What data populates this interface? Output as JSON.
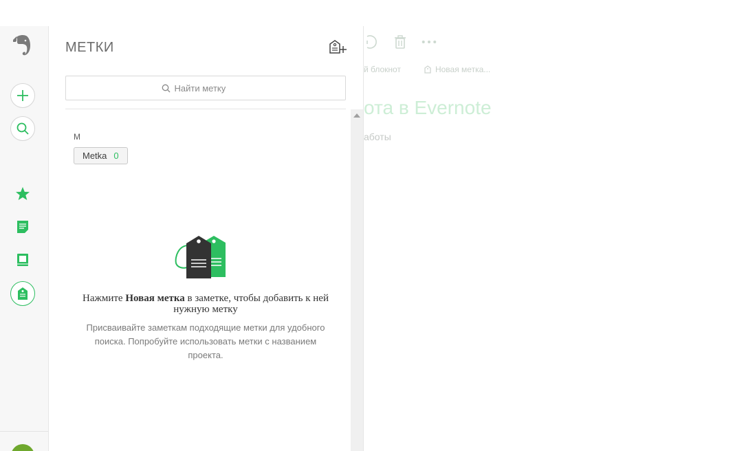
{
  "editor": {
    "meta_notebook": "й блокнот",
    "meta_new_tag": "Новая метка...",
    "note_title": "ота в Evernote",
    "note_body": "аботы"
  },
  "panel": {
    "title": "МЕТКИ",
    "search_placeholder": "Найти метку",
    "group_letter": "М",
    "tags": [
      {
        "name": "Metka",
        "count": "0"
      }
    ],
    "empty_state": {
      "title_prefix": "Нажмите ",
      "title_bold": "Новая метка",
      "title_suffix": " в заметке, чтобы добавить к ней нужную метку",
      "description": "Присваивайте заметкам подходящие метки для удобного поиска. Попробуйте использовать метки с названием проекта."
    }
  },
  "colors": {
    "accent": "#2dbe60",
    "rail_bg": "#f7f7f7",
    "muted_text": "#7a7a7a"
  },
  "icons": {
    "rail": [
      "evernote-logo",
      "plus-icon",
      "search-icon",
      "star-icon",
      "note-icon",
      "notebook-icon",
      "tag-icon"
    ],
    "panel": [
      "new-tag-icon",
      "search-icon",
      "tags-illustration"
    ]
  }
}
